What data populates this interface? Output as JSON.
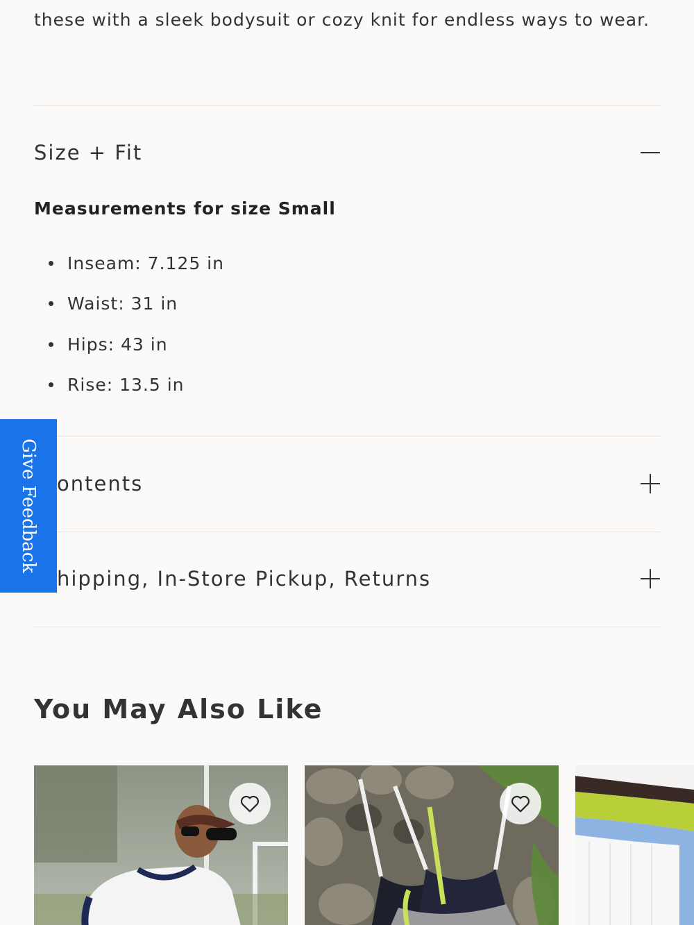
{
  "description": {
    "text": "these with a sleek bodysuit or cozy knit for endless ways to wear."
  },
  "accordions": [
    {
      "title": "Size + Fit",
      "state": "expanded"
    },
    {
      "title": "ontents",
      "state": "collapsed"
    },
    {
      "title": "hipping, In-Store Pickup, Returns",
      "state": "collapsed"
    }
  ],
  "size_fit": {
    "heading": "Measurements for size Small",
    "items": [
      "Inseam: 7.125 in",
      "Waist: 31 in",
      "Hips: 43 in",
      "Rise: 13.5 in"
    ]
  },
  "feedback_tab": {
    "label": "Give Feedback",
    "color": "#1a73e8"
  },
  "recommendations": {
    "title": "You May Also Like",
    "products": [
      {
        "image": "woman in white top and visor",
        "wishlist_icon": "heart-icon"
      },
      {
        "image": "stacked knit bralettes on rocks",
        "wishlist_icon": "heart-icon"
      },
      {
        "image": "colorful pull-on shorts",
        "wishlist_icon": null
      }
    ]
  },
  "colors": {
    "background": "#fcfaf9",
    "text": "#333333",
    "divider": "#e6e2df"
  }
}
